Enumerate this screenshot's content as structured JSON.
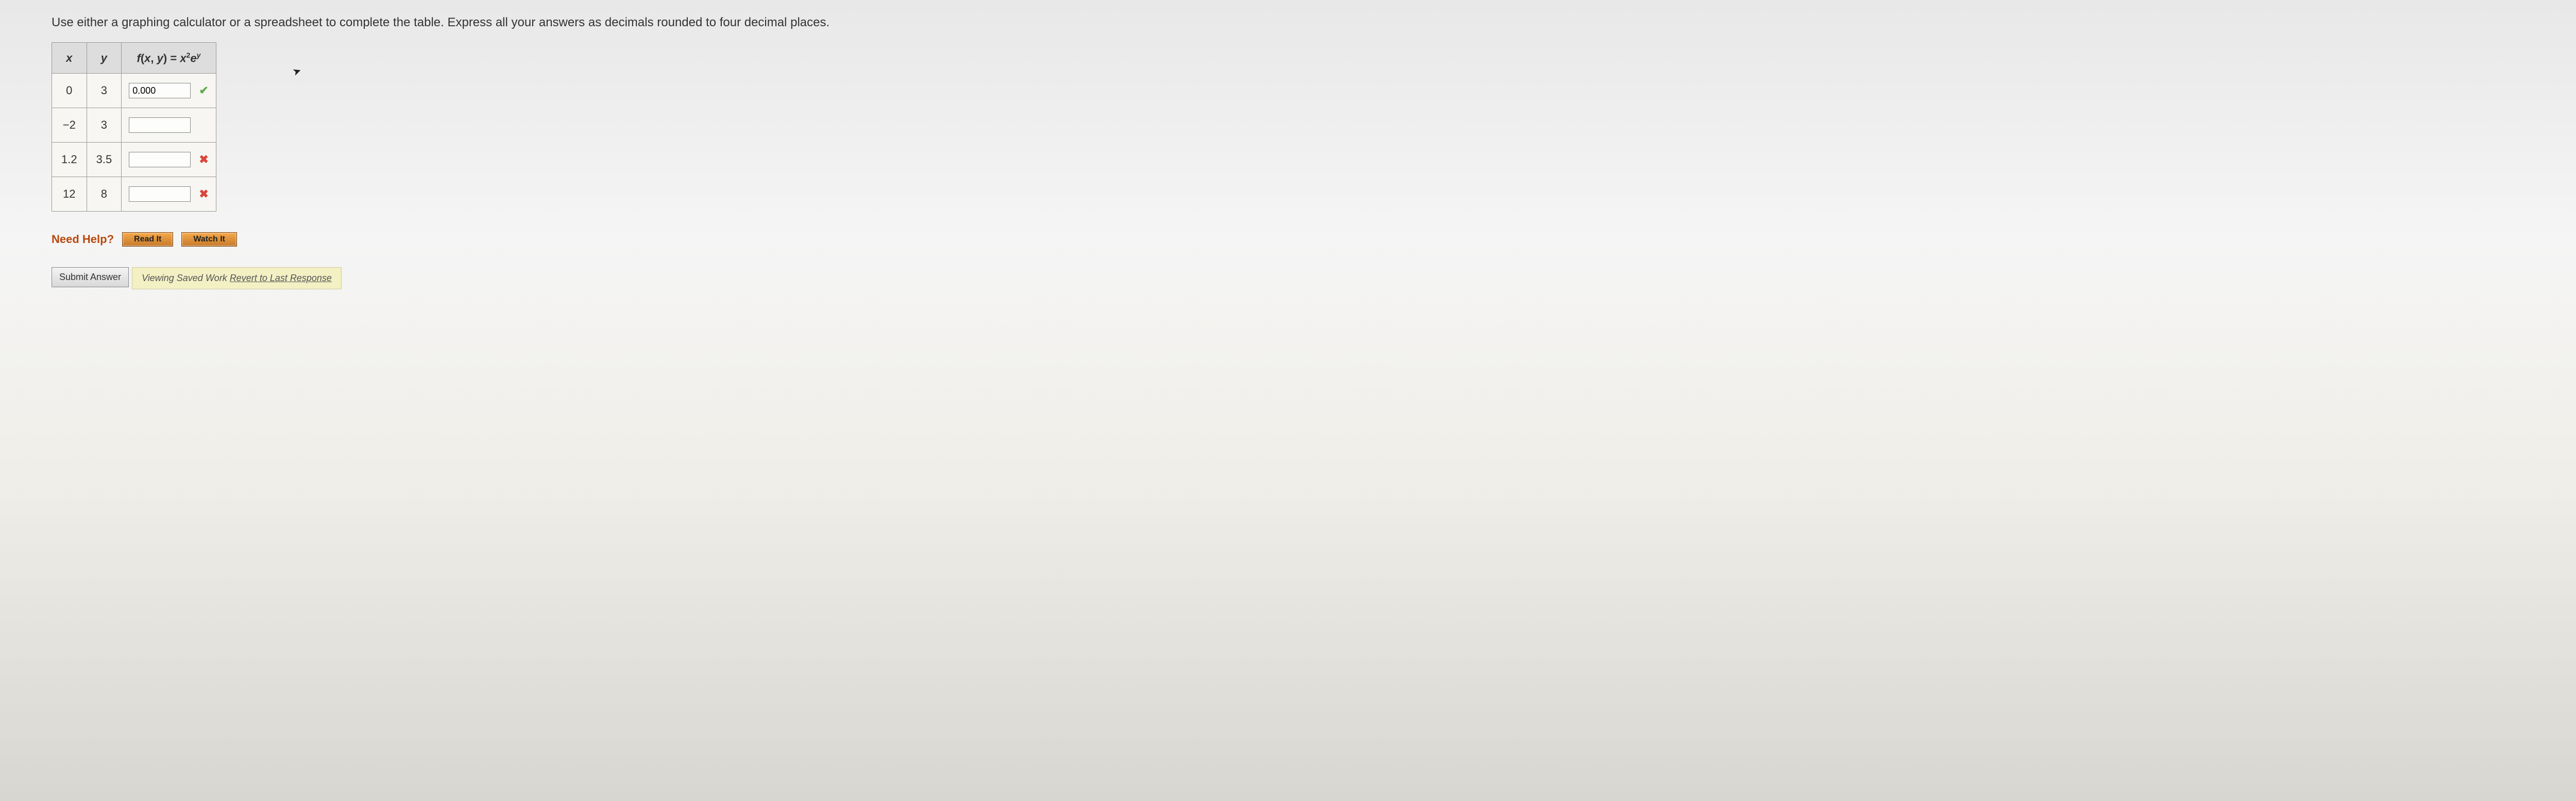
{
  "instruction": "Use either a graphing calculator or a spreadsheet to complete the table. Express all your answers as decimals rounded to four decimal places.",
  "table": {
    "headers": {
      "x": "x",
      "y": "y"
    },
    "fn_label_parts": {
      "f": "f",
      "open": "(",
      "x": "x",
      "comma": ", ",
      "y": "y",
      "close": ") = ",
      "x2": "x",
      "exp2": "2",
      "e": "e",
      "expy": "y"
    },
    "rows": [
      {
        "x": "0",
        "y": "3",
        "value": "0.000",
        "status": "correct"
      },
      {
        "x": "−2",
        "y": "3",
        "value": "",
        "status": "none"
      },
      {
        "x": "1.2",
        "y": "3.5",
        "value": "",
        "status": "wrong"
      },
      {
        "x": "12",
        "y": "8",
        "value": "",
        "status": "wrong"
      }
    ]
  },
  "help": {
    "label": "Need Help?",
    "read": "Read It",
    "watch": "Watch It"
  },
  "footer": {
    "submit": "Submit Answer",
    "saved_prefix": "Viewing Saved Work ",
    "revert": "Revert to Last Response"
  },
  "icons": {
    "check": "✔",
    "cross": "✖"
  }
}
